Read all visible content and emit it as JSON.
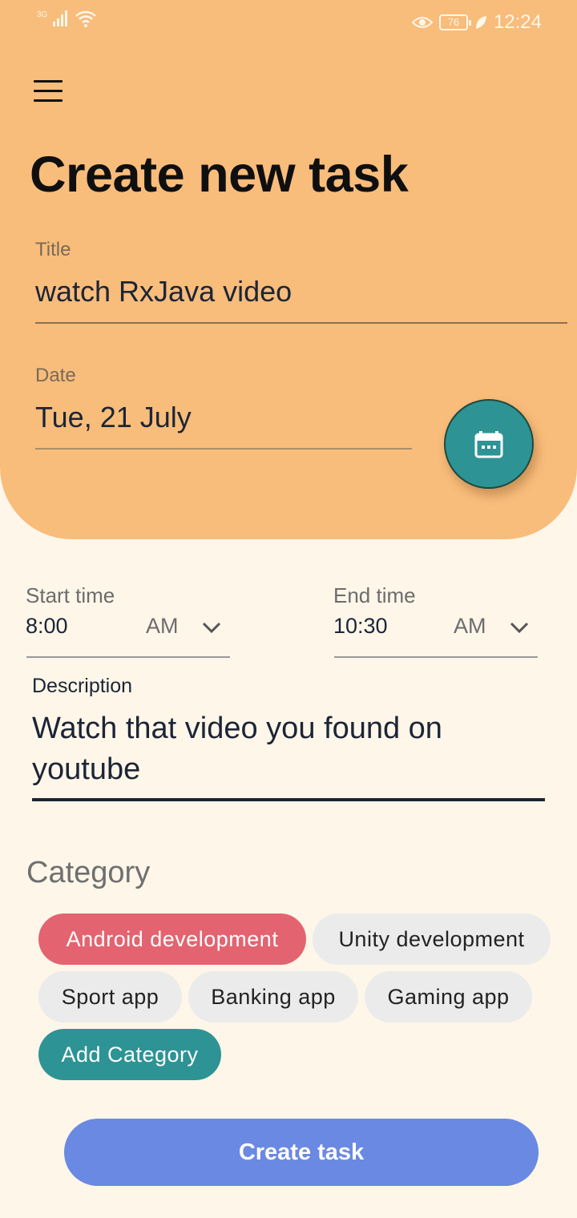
{
  "status_bar": {
    "signal_label": "3G",
    "battery": "76",
    "time": "12:24",
    "icons": [
      "signal-icon",
      "wifi-icon",
      "eye-icon",
      "battery-icon",
      "leaf-icon"
    ]
  },
  "header": {
    "menu_icon": "hamburger-menu-icon",
    "title": "Create new task"
  },
  "form": {
    "title_label": "Title",
    "title_value": "watch RxJava video",
    "date_label": "Date",
    "date_value": "Tue, 21 July",
    "calendar_icon": "calendar-icon",
    "start_time": {
      "label": "Start time",
      "value": "8:00",
      "ampm": "AM"
    },
    "end_time": {
      "label": "End time",
      "value": "10:30",
      "ampm": "AM"
    },
    "description_label": "Description",
    "description_value": "Watch that video you found on youtube"
  },
  "category": {
    "title": "Category",
    "chips": [
      {
        "label": "Android development",
        "state": "selected"
      },
      {
        "label": "Unity development",
        "state": "default"
      },
      {
        "label": "Sport app",
        "state": "default"
      },
      {
        "label": "Banking app",
        "state": "default"
      },
      {
        "label": "Gaming app",
        "state": "default"
      },
      {
        "label": "Add Category",
        "state": "action"
      }
    ]
  },
  "actions": {
    "create_label": "Create task"
  },
  "colors": {
    "header_bg": "#f8bc7b",
    "page_bg": "#fdf6e9",
    "accent_teal": "#2e9394",
    "chip_selected": "#e36470",
    "chip_default": "#ebebeb",
    "primary_button": "#6a89e2",
    "text_dark": "#1c2536"
  }
}
